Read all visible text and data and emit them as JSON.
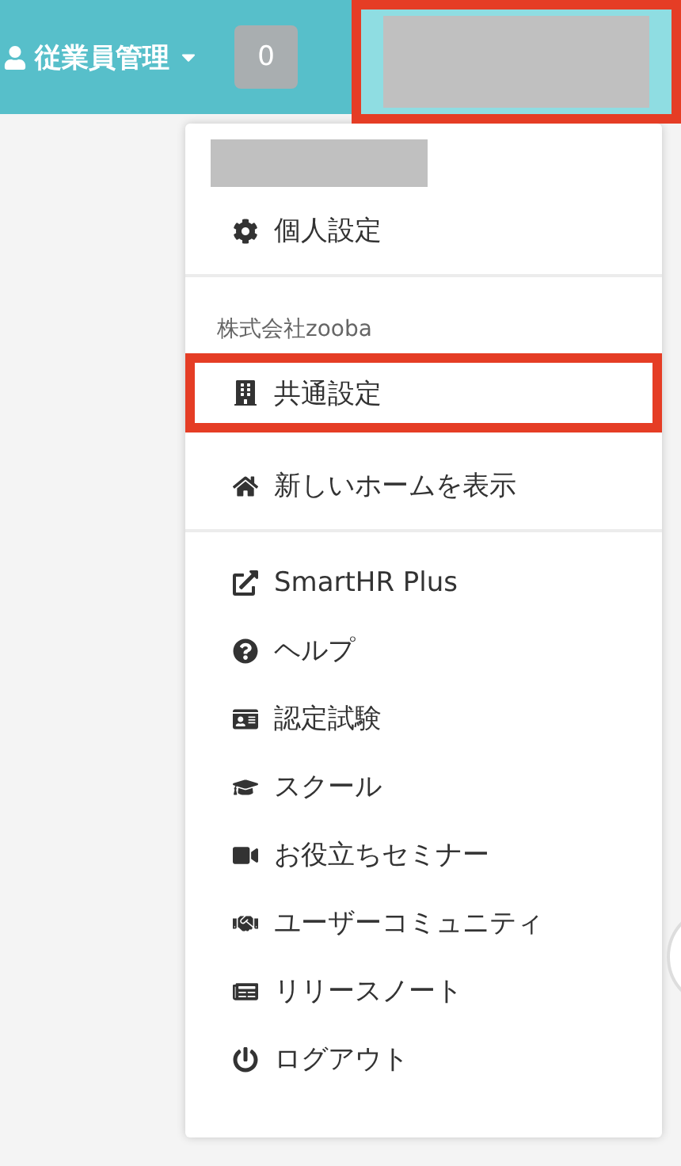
{
  "header": {
    "menu": {
      "label": "従業員管理"
    },
    "badge": "0",
    "account": {
      "redacted": true,
      "highlighted": true
    }
  },
  "dropdown": {
    "sections": [
      {
        "redacted": true,
        "items": [
          {
            "label": "個人設定",
            "highlighted": false
          }
        ]
      },
      {
        "heading": "株式会社zooba",
        "items": [
          {
            "label": "共通設定",
            "highlighted": true
          },
          {
            "label": "新しいホームを表示",
            "highlighted": false
          }
        ]
      },
      {
        "items": [
          {
            "label": "SmartHR Plus",
            "highlighted": false
          },
          {
            "label": "ヘルプ",
            "highlighted": false
          },
          {
            "label": "認定試験",
            "highlighted": false
          },
          {
            "label": "スクール",
            "highlighted": false
          },
          {
            "label": "お役立ちセミナー",
            "highlighted": false
          },
          {
            "label": "ユーザーコミュニティ",
            "highlighted": false
          },
          {
            "label": "リリースノート",
            "highlighted": false
          },
          {
            "label": "ログアウト",
            "highlighted": false
          }
        ]
      }
    ]
  }
}
